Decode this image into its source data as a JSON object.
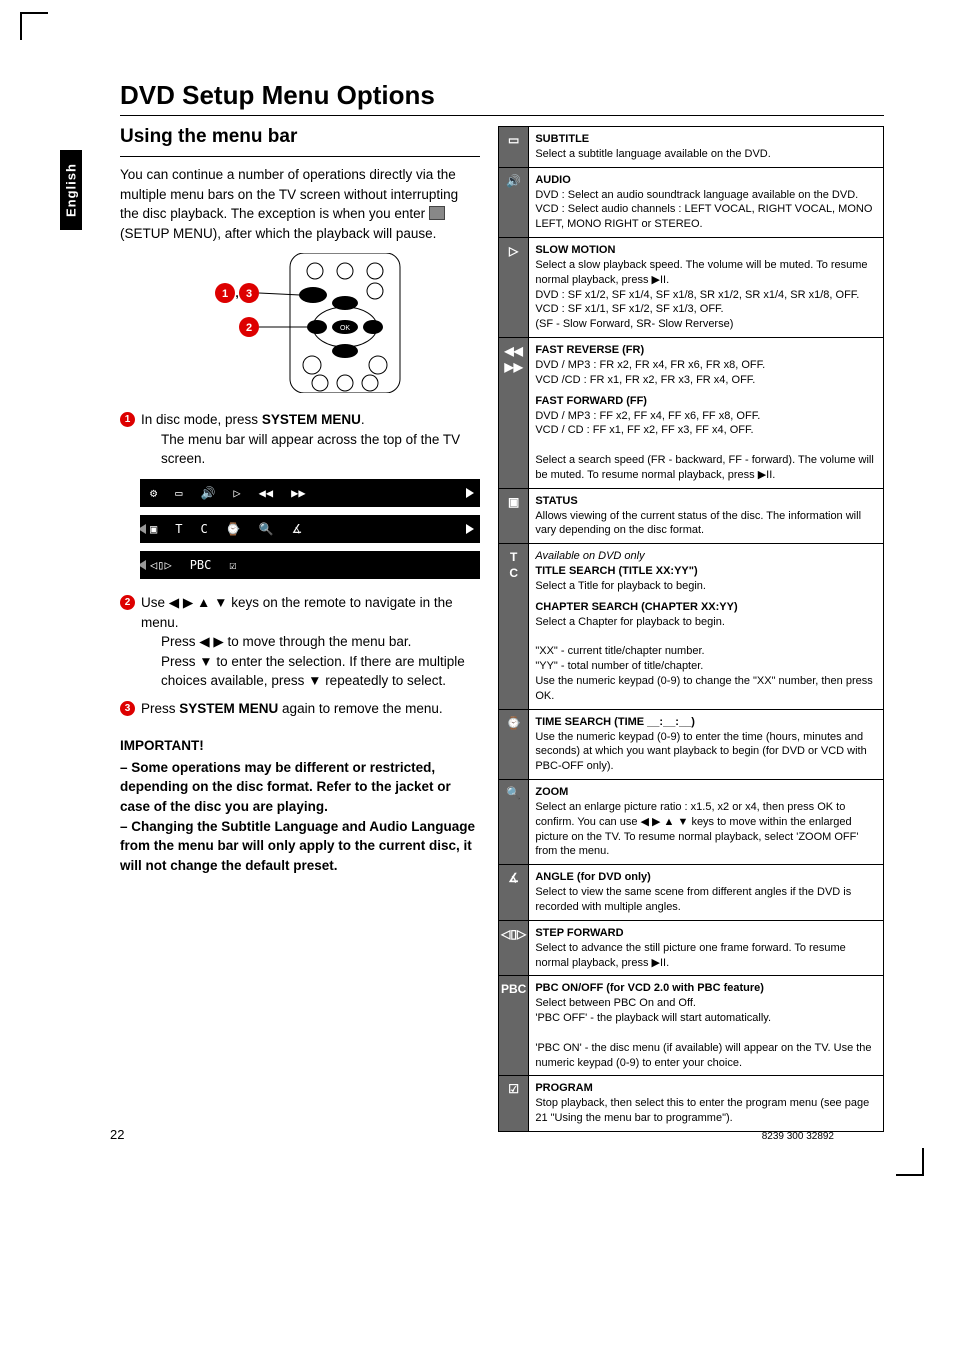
{
  "page": {
    "language_tab": "English",
    "main_title": "DVD Setup Menu Options",
    "page_number": "22",
    "footer_code": "8239 300 32892"
  },
  "left": {
    "section_heading": "Using the menu bar",
    "intro": "You can continue a number of operations directly via the multiple menu bars on the TV screen without interrupting the disc playback. The exception is when you enter ",
    "intro_after_icon": " (SETUP MENU), after which the playback will pause.",
    "remote_labels": {
      "combo": "1, 3",
      "two": "2"
    },
    "steps": {
      "s1_a": "In disc mode, press ",
      "s1_bold": "SYSTEM MENU",
      "s1_b": ".",
      "s1_c": "The menu bar will appear across the top of the TV screen.",
      "s2_a": "Use ◀ ▶ ▲ ▼ keys on the remote to navigate in the menu.",
      "s2_b": "Press ◀ ▶ to move through the menu bar.",
      "s2_c": "Press ▼ to enter the selection.  If there are multiple choices available, press ▼ repeatedly to select.",
      "s3_a": "Press ",
      "s3_bold": "SYSTEM MENU",
      "s3_b": " again to remove the menu."
    },
    "menu_strip_icons": {
      "row1": [
        "⚙",
        "▭",
        "🔊",
        "▷",
        "◀◀",
        "▶▶"
      ],
      "row2": [
        "▣",
        "T",
        "C",
        "⌚",
        "🔍",
        "∡"
      ],
      "row3": [
        "◁▯▷",
        "PBC",
        "☑"
      ]
    },
    "important": {
      "heading": "IMPORTANT!",
      "line1": "– Some operations may be different or restricted, depending on the disc format. Refer to the jacket or case of the disc you are playing.",
      "line2": "– Changing the Subtitle Language and Audio Language from the menu bar will only apply to the current disc, it will not change the default preset."
    }
  },
  "features": [
    {
      "icon": "▭",
      "title": "SUBTITLE",
      "body": "Select a subtitle language available on the DVD."
    },
    {
      "icon": "🔊",
      "title": "AUDIO",
      "body": "DVD : Select an audio soundtrack language available on the DVD.\nVCD : Select audio channels : LEFT VOCAL, RIGHT VOCAL, MONO LEFT, MONO RIGHT or STEREO."
    },
    {
      "icon": "▷",
      "title": "SLOW MOTION",
      "body": "Select a slow playback speed. The volume will be muted. To resume normal playback, press ▶II.\nDVD : SF x1/2, SF x1/4, SF x1/8, SR x1/2, SR x1/4, SR x1/8, OFF.\nVCD : SF x1/1, SF x1/2, SF x1/3, OFF.\n(SF - Slow Forward, SR- Slow Rerverse)"
    },
    {
      "icon": "◀◀ ▶▶",
      "title": "FAST REVERSE (FR)",
      "body": "DVD / MP3 : FR x2, FR x4, FR x6, FR x8, OFF.\nVCD /CD : FR x1, FR x2, FR x3, FR x4, OFF.",
      "title2": "FAST FORWARD (FF)",
      "body2": "DVD / MP3 : FF x2, FF x4, FF x6, FF x8, OFF.\nVCD / CD : FF x1, FF x2, FF x3, FF x4, OFF.\n\nSelect a search speed (FR - backward, FF - forward). The volume will be muted. To resume normal playback, press ▶II."
    },
    {
      "icon": "▣",
      "title": "STATUS",
      "body": "Allows viewing of the current status of the disc. The information will vary depending on the disc format."
    },
    {
      "icon": "T C",
      "pretitle": "Available on DVD only",
      "title": "TITLE SEARCH (TITLE XX:YY\")",
      "body": "Select a Title for playback to begin.",
      "title2": "CHAPTER SEARCH (CHAPTER XX:YY)",
      "body2": "Select a Chapter for playback to begin.\n\n\"XX\" - current title/chapter number.\n\"YY\" - total number of title/chapter.\nUse the numeric keypad (0-9) to change the \"XX\" number, then press OK."
    },
    {
      "icon": "⌚",
      "title": "TIME SEARCH (TIME __:__:__)",
      "body": "Use the numeric keypad (0-9) to enter the time (hours, minutes and seconds) at which you want playback to begin (for DVD or VCD with PBC-OFF only)."
    },
    {
      "icon": "🔍",
      "title": "ZOOM",
      "body": "Select an enlarge picture ratio : x1.5, x2 or x4, then press OK to confirm. You can use ◀ ▶ ▲ ▼ keys to move within the enlarged picture on the TV. To resume normal playback, select 'ZOOM OFF' from the menu."
    },
    {
      "icon": "∡",
      "title": "ANGLE (for DVD only)",
      "body": "Select to view the same scene from different angles if the DVD is recorded with multiple angles."
    },
    {
      "icon": "◁▯▷",
      "title": "STEP FORWARD",
      "body": "Select to advance the still picture one frame forward. To resume normal playback, press ▶II."
    },
    {
      "icon": "PBC",
      "title": "PBC ON/OFF (for VCD 2.0 with PBC feature)",
      "body": "Select between PBC On and Off.\n'PBC OFF' - the playback will start automatically.\n\n'PBC ON' - the disc menu (if available) will appear on the TV. Use the numeric keypad (0-9) to enter your choice."
    },
    {
      "icon": "☑",
      "title": "PROGRAM",
      "body": "Stop playback, then select this to enter the program menu (see page 21 \"Using the menu bar to programme\")."
    }
  ]
}
